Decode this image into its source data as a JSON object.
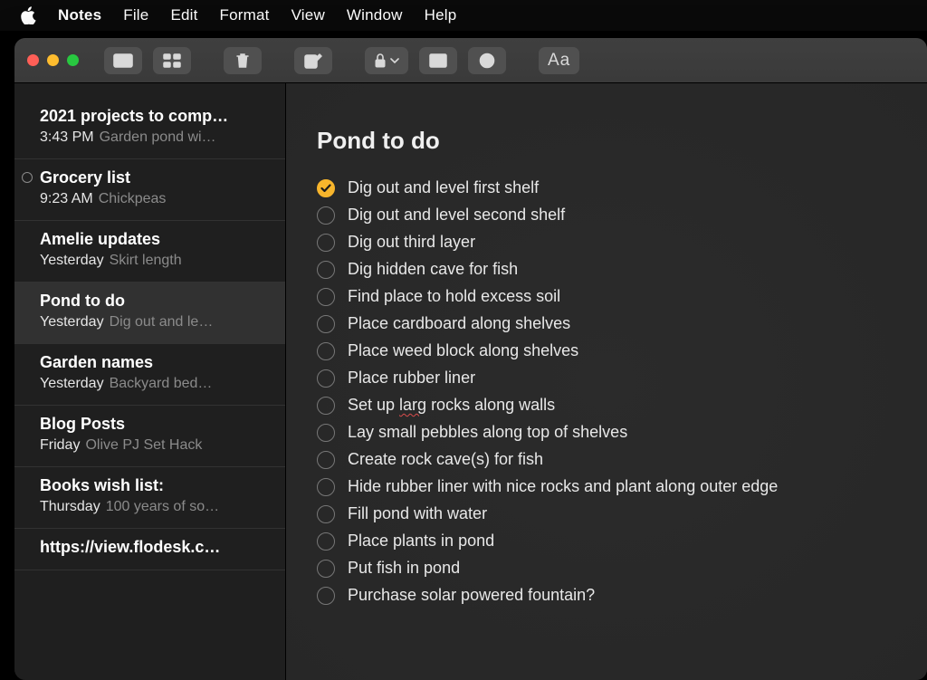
{
  "menubar": {
    "app": "Notes",
    "items": [
      "File",
      "Edit",
      "Format",
      "View",
      "Window",
      "Help"
    ]
  },
  "toolbar": {
    "buttons": [
      {
        "name": "sidebar-toggle-icon"
      },
      {
        "name": "gallery-view-icon"
      },
      {
        "name": "trash-icon"
      },
      {
        "name": "compose-icon"
      },
      {
        "name": "lock-icon",
        "dropdown": true
      },
      {
        "name": "table-icon"
      },
      {
        "name": "checklist-icon"
      },
      {
        "name": "text-style-icon",
        "label": "Aa"
      }
    ]
  },
  "sidebar": {
    "notes": [
      {
        "title": "2021 projects to comp…",
        "time": "3:43 PM",
        "preview": "Garden pond wi…",
        "pinned": false,
        "selected": false
      },
      {
        "title": "Grocery list",
        "time": "9:23 AM",
        "preview": "Chickpeas",
        "pinned": true,
        "selected": false
      },
      {
        "title": "Amelie updates",
        "time": "Yesterday",
        "preview": "Skirt length",
        "pinned": false,
        "selected": false
      },
      {
        "title": "Pond to do",
        "time": "Yesterday",
        "preview": "Dig out and le…",
        "pinned": false,
        "selected": true
      },
      {
        "title": "Garden names",
        "time": "Yesterday",
        "preview": "Backyard bed…",
        "pinned": false,
        "selected": false
      },
      {
        "title": "Blog Posts",
        "time": "Friday",
        "preview": "Olive PJ Set Hack",
        "pinned": false,
        "selected": false
      },
      {
        "title": "Books wish list:",
        "time": "Thursday",
        "preview": "100 years of so…",
        "pinned": false,
        "selected": false
      },
      {
        "title": "https://view.flodesk.c…",
        "time": "",
        "preview": "",
        "pinned": false,
        "selected": false
      }
    ]
  },
  "note": {
    "title": "Pond to do",
    "items": [
      {
        "text": "Dig out and level first shelf",
        "done": true
      },
      {
        "text": "Dig out and level second shelf",
        "done": false
      },
      {
        "text": "Dig out third layer",
        "done": false
      },
      {
        "text": "Dig hidden cave for fish",
        "done": false
      },
      {
        "text": "Find place to hold excess soil",
        "done": false
      },
      {
        "text": "Place cardboard along shelves",
        "done": false
      },
      {
        "text": "Place weed block along shelves",
        "done": false
      },
      {
        "text": "Place rubber liner",
        "done": false
      },
      {
        "text": "Set up ",
        "spell": "larg",
        "rest": " rocks along walls",
        "done": false
      },
      {
        "text": "Lay small pebbles along top of shelves",
        "done": false
      },
      {
        "text": "Create rock cave(s) for fish",
        "done": false
      },
      {
        "text": "Hide rubber liner with nice rocks and plant along outer edge",
        "done": false
      },
      {
        "text": "Fill pond with water",
        "done": false
      },
      {
        "text": "Place plants in pond",
        "done": false
      },
      {
        "text": "Put fish in pond",
        "done": false
      },
      {
        "text": "Purchase solar powered fountain?",
        "done": false
      }
    ]
  }
}
